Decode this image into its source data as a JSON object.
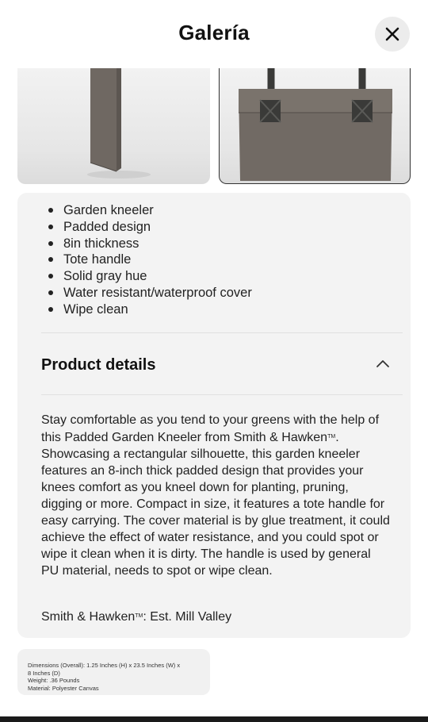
{
  "header": {
    "title": "Galería",
    "close_label": "Close"
  },
  "gallery": {
    "images": [
      {
        "alt": "garden-kneeler-side-view"
      },
      {
        "alt": "garden-kneeler-tote-handle-view"
      }
    ]
  },
  "highlights": [
    "Garden kneeler",
    "Padded design",
    "8in thickness",
    "Tote handle",
    "Solid gray hue",
    "Water resistant/waterproof cover",
    "Wipe clean"
  ],
  "details": {
    "title": "Product details",
    "expanded": true,
    "description_before_tm": "Stay comfortable as you tend to your greens with the help of this Padded Garden Kneeler from Smith & Hawken",
    "tm": "TM",
    "description_after_tm": ". Showcasing a rectangular silhouette, this garden kneeler features an 8-inch thick padded design that provides your knees comfort as you kneel down for planting, pruning, digging or more. Compact in size, it features a tote handle for easy carrying. The cover material is by glue treatment, it could achieve the effect of water resistance, and you could spot or wipe it clean when it is dirty. The handle is used by general PU material, needs to spot or wipe clean.",
    "brand_before_tm": "Smith & Hawken",
    "brand_after_tm": ": Est. Mill Valley"
  },
  "specs": [
    "Dimensions (Overall):  1.25 Inches (H) x 23.5 Inches (W) x",
    "8 Inches (D)",
    "Weight:  .36 Pounds",
    "Material:  Polyester Canvas"
  ],
  "colors": {
    "product_gray": "#6f6862",
    "handle_dark": "#3a3a38",
    "panel_bg": "#f3f3f3"
  }
}
